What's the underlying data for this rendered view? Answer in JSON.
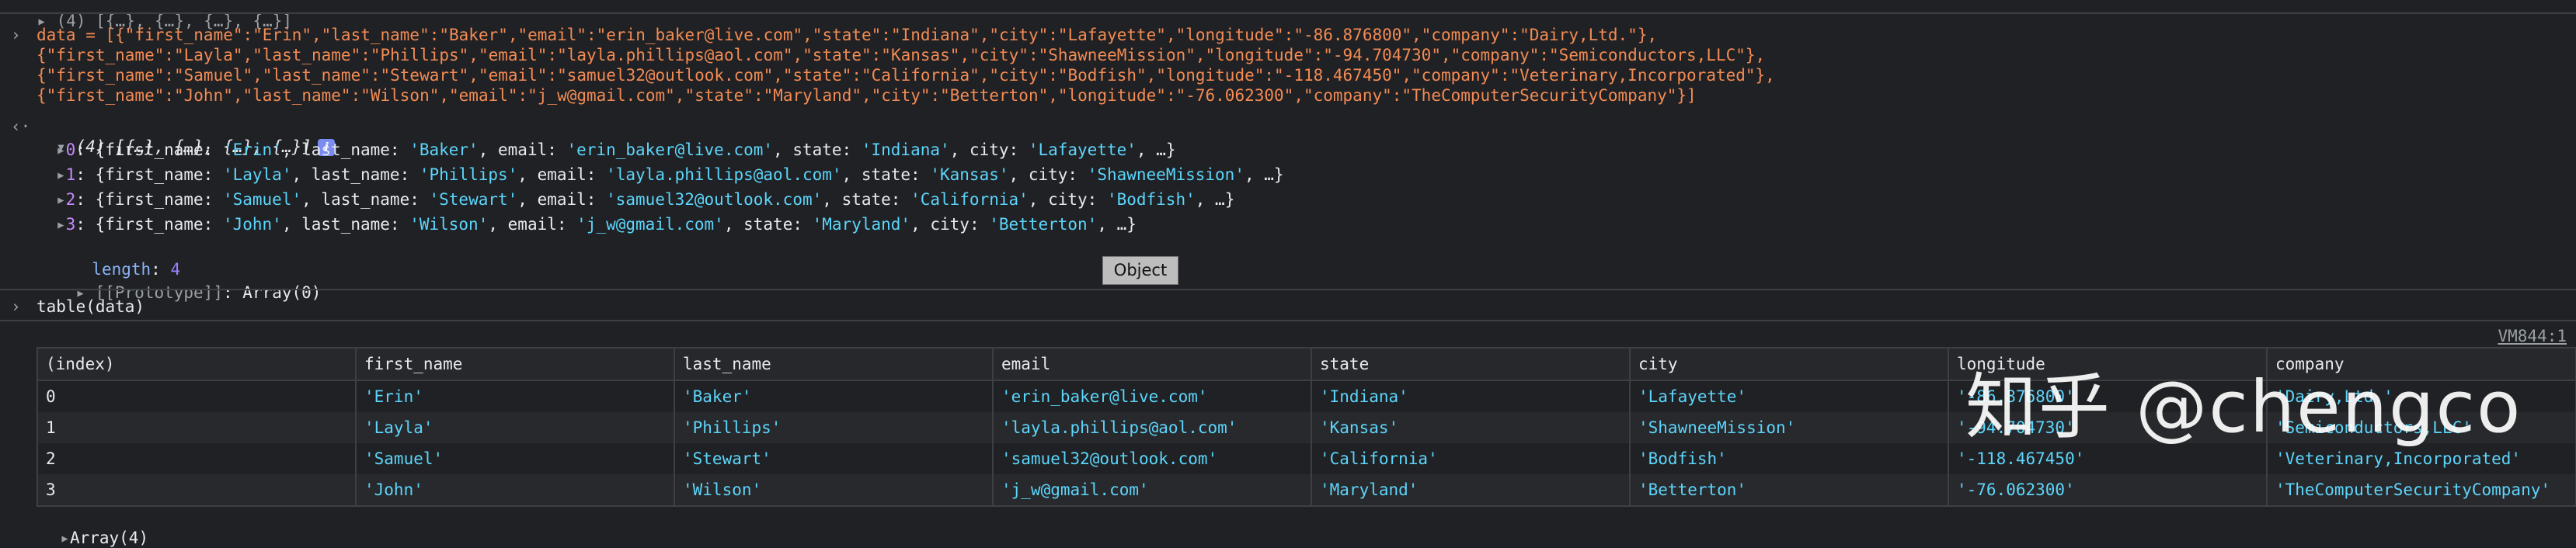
{
  "top_line": "(4) [{…}, {…}, {…}, {…}]",
  "input": {
    "line1": "data = [{\"first_name\":\"Erin\",\"last_name\":\"Baker\",\"email\":\"erin_baker@live.com\",\"state\":\"Indiana\",\"city\":\"Lafayette\",\"longitude\":\"-86.876800\",\"company\":\"Dairy,Ltd.\"},",
    "line2": "{\"first_name\":\"Layla\",\"last_name\":\"Phillips\",\"email\":\"layla.phillips@aol.com\",\"state\":\"Kansas\",\"city\":\"ShawneeMission\",\"longitude\":\"-94.704730\",\"company\":\"Semiconductors,LLC\"},",
    "line3": "{\"first_name\":\"Samuel\",\"last_name\":\"Stewart\",\"email\":\"samuel32@outlook.com\",\"state\":\"California\",\"city\":\"Bodfish\",\"longitude\":\"-118.467450\",\"company\":\"Veterinary,Incorporated\"},",
    "line4": "{\"first_name\":\"John\",\"last_name\":\"Wilson\",\"email\":\"j_w@gmail.com\",\"state\":\"Maryland\",\"city\":\"Betterton\",\"longitude\":\"-76.062300\",\"company\":\"TheComputerSecurityCompany\"}]"
  },
  "result_header": "(4) [{…}, {…}, {…}, {…}]",
  "info_badge": "i",
  "items": [
    {
      "index": "0",
      "first_name": "'Erin'",
      "last_name": "'Baker'",
      "email": "'erin_baker@live.com'",
      "state": "'Indiana'",
      "city": "'Lafayette'"
    },
    {
      "index": "1",
      "first_name": "'Layla'",
      "last_name": "'Phillips'",
      "email": "'layla.phillips@aol.com'",
      "state": "'Kansas'",
      "city": "'ShawneeMission'"
    },
    {
      "index": "2",
      "first_name": "'Samuel'",
      "last_name": "'Stewart'",
      "email": "'samuel32@outlook.com'",
      "state": "'California'",
      "city": "'Bodfish'"
    },
    {
      "index": "3",
      "first_name": "'John'",
      "last_name": "'Wilson'",
      "email": "'j_w@gmail.com'",
      "state": "'Maryland'",
      "city": "'Betterton'"
    }
  ],
  "length_label": "length",
  "length_value": "4",
  "prototype_label": "[[Prototype]]",
  "prototype_value": "Array(0)",
  "tooltip": "Object",
  "command": "table(data)",
  "vm_link": "VM844:1",
  "table": {
    "headers": [
      "(index)",
      "first_name",
      "last_name",
      "email",
      "state",
      "city",
      "longitude",
      "company"
    ],
    "rows": [
      [
        "0",
        "'Erin'",
        "'Baker'",
        "'erin_baker@live.com'",
        "'Indiana'",
        "'Lafayette'",
        "'-86.876800'",
        "'Dairy,Ltd.'"
      ],
      [
        "1",
        "'Layla'",
        "'Phillips'",
        "'layla.phillips@aol.com'",
        "'Kansas'",
        "'ShawneeMission'",
        "'-94.704730'",
        "'Semiconductors,LLC'"
      ],
      [
        "2",
        "'Samuel'",
        "'Stewart'",
        "'samuel32@outlook.com'",
        "'California'",
        "'Bodfish'",
        "'-118.467450'",
        "'Veterinary,Incorporated'"
      ],
      [
        "3",
        "'John'",
        "'Wilson'",
        "'j_w@gmail.com'",
        "'Maryland'",
        "'Betterton'",
        "'-76.062300'",
        "'TheComputerSecurityCompany'"
      ]
    ]
  },
  "footer": "Array(4)",
  "watermark": "知乎 @chengco",
  "colors": {
    "background": "#202124",
    "string": "#5cd5fb",
    "key_orange": "#f28b54",
    "property": "#c58af9"
  }
}
